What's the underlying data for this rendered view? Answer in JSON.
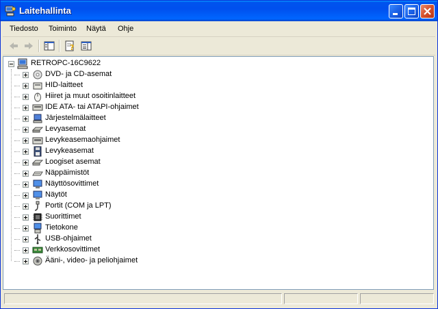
{
  "window": {
    "title": "Laitehallinta",
    "icon": "device-manager-icon"
  },
  "title_buttons": [
    "minimize-button",
    "maximize-button",
    "close-button"
  ],
  "menu": [
    "Tiedosto",
    "Toiminto",
    "Näytä",
    "Ohje"
  ],
  "toolbar": {
    "buttons": [
      "back-arrow-icon",
      "forward-arrow-icon",
      "show-hide-console-tree-icon",
      "properties-help-icon",
      "export-list-icon"
    ]
  },
  "tree": {
    "root": "RETROPC-16C9622",
    "categories": [
      {
        "label": "DVD- ja CD-asemat",
        "icon": "dvd-cd-drive-icon"
      },
      {
        "label": "HID-laitteet",
        "icon": "hid-device-icon"
      },
      {
        "label": "Hiiret ja muut osoitinlaitteet",
        "icon": "mouse-icon"
      },
      {
        "label": "IDE ATA- tai ATAPI-ohjaimet",
        "icon": "ide-controller-icon"
      },
      {
        "label": "Järjestelmälaitteet",
        "icon": "system-device-icon"
      },
      {
        "label": "Levyasemat",
        "icon": "disk-drive-icon"
      },
      {
        "label": "Levykeasemaohjaimet",
        "icon": "floppy-controller-icon"
      },
      {
        "label": "Levykeasemat",
        "icon": "floppy-drive-icon"
      },
      {
        "label": "Loogiset asemat",
        "icon": "logical-drive-icon"
      },
      {
        "label": "Näppäimistöt",
        "icon": "keyboard-icon"
      },
      {
        "label": "Näyttösovittimet",
        "icon": "display-adapter-icon"
      },
      {
        "label": "Näytöt",
        "icon": "monitor-icon"
      },
      {
        "label": "Portit (COM ja LPT)",
        "icon": "port-icon"
      },
      {
        "label": "Suorittimet",
        "icon": "processor-icon"
      },
      {
        "label": "Tietokone",
        "icon": "computer-icon"
      },
      {
        "label": "USB-ohjaimet",
        "icon": "usb-icon"
      },
      {
        "label": "Verkkosovittimet",
        "icon": "network-adapter-icon"
      },
      {
        "label": "Ääni-, video- ja peliohjaimet",
        "icon": "sound-icon"
      }
    ]
  },
  "colors": {
    "titlebar": "#0054E3",
    "window_bg": "#ECE9D8",
    "content_bg": "#FFFFFF"
  }
}
